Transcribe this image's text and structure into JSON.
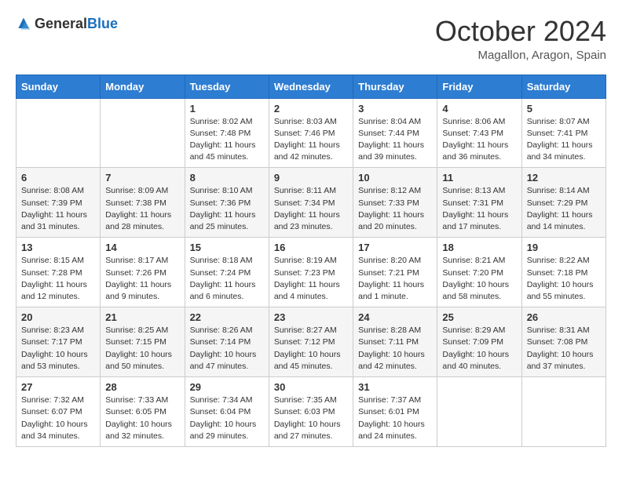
{
  "header": {
    "logo_general": "General",
    "logo_blue": "Blue",
    "month": "October 2024",
    "location": "Magallon, Aragon, Spain"
  },
  "days_of_week": [
    "Sunday",
    "Monday",
    "Tuesday",
    "Wednesday",
    "Thursday",
    "Friday",
    "Saturday"
  ],
  "weeks": [
    [
      {
        "day": "",
        "info": ""
      },
      {
        "day": "",
        "info": ""
      },
      {
        "day": "1",
        "info": "Sunrise: 8:02 AM\nSunset: 7:48 PM\nDaylight: 11 hours and 45 minutes."
      },
      {
        "day": "2",
        "info": "Sunrise: 8:03 AM\nSunset: 7:46 PM\nDaylight: 11 hours and 42 minutes."
      },
      {
        "day": "3",
        "info": "Sunrise: 8:04 AM\nSunset: 7:44 PM\nDaylight: 11 hours and 39 minutes."
      },
      {
        "day": "4",
        "info": "Sunrise: 8:06 AM\nSunset: 7:43 PM\nDaylight: 11 hours and 36 minutes."
      },
      {
        "day": "5",
        "info": "Sunrise: 8:07 AM\nSunset: 7:41 PM\nDaylight: 11 hours and 34 minutes."
      }
    ],
    [
      {
        "day": "6",
        "info": "Sunrise: 8:08 AM\nSunset: 7:39 PM\nDaylight: 11 hours and 31 minutes."
      },
      {
        "day": "7",
        "info": "Sunrise: 8:09 AM\nSunset: 7:38 PM\nDaylight: 11 hours and 28 minutes."
      },
      {
        "day": "8",
        "info": "Sunrise: 8:10 AM\nSunset: 7:36 PM\nDaylight: 11 hours and 25 minutes."
      },
      {
        "day": "9",
        "info": "Sunrise: 8:11 AM\nSunset: 7:34 PM\nDaylight: 11 hours and 23 minutes."
      },
      {
        "day": "10",
        "info": "Sunrise: 8:12 AM\nSunset: 7:33 PM\nDaylight: 11 hours and 20 minutes."
      },
      {
        "day": "11",
        "info": "Sunrise: 8:13 AM\nSunset: 7:31 PM\nDaylight: 11 hours and 17 minutes."
      },
      {
        "day": "12",
        "info": "Sunrise: 8:14 AM\nSunset: 7:29 PM\nDaylight: 11 hours and 14 minutes."
      }
    ],
    [
      {
        "day": "13",
        "info": "Sunrise: 8:15 AM\nSunset: 7:28 PM\nDaylight: 11 hours and 12 minutes."
      },
      {
        "day": "14",
        "info": "Sunrise: 8:17 AM\nSunset: 7:26 PM\nDaylight: 11 hours and 9 minutes."
      },
      {
        "day": "15",
        "info": "Sunrise: 8:18 AM\nSunset: 7:24 PM\nDaylight: 11 hours and 6 minutes."
      },
      {
        "day": "16",
        "info": "Sunrise: 8:19 AM\nSunset: 7:23 PM\nDaylight: 11 hours and 4 minutes."
      },
      {
        "day": "17",
        "info": "Sunrise: 8:20 AM\nSunset: 7:21 PM\nDaylight: 11 hours and 1 minute."
      },
      {
        "day": "18",
        "info": "Sunrise: 8:21 AM\nSunset: 7:20 PM\nDaylight: 10 hours and 58 minutes."
      },
      {
        "day": "19",
        "info": "Sunrise: 8:22 AM\nSunset: 7:18 PM\nDaylight: 10 hours and 55 minutes."
      }
    ],
    [
      {
        "day": "20",
        "info": "Sunrise: 8:23 AM\nSunset: 7:17 PM\nDaylight: 10 hours and 53 minutes."
      },
      {
        "day": "21",
        "info": "Sunrise: 8:25 AM\nSunset: 7:15 PM\nDaylight: 10 hours and 50 minutes."
      },
      {
        "day": "22",
        "info": "Sunrise: 8:26 AM\nSunset: 7:14 PM\nDaylight: 10 hours and 47 minutes."
      },
      {
        "day": "23",
        "info": "Sunrise: 8:27 AM\nSunset: 7:12 PM\nDaylight: 10 hours and 45 minutes."
      },
      {
        "day": "24",
        "info": "Sunrise: 8:28 AM\nSunset: 7:11 PM\nDaylight: 10 hours and 42 minutes."
      },
      {
        "day": "25",
        "info": "Sunrise: 8:29 AM\nSunset: 7:09 PM\nDaylight: 10 hours and 40 minutes."
      },
      {
        "day": "26",
        "info": "Sunrise: 8:31 AM\nSunset: 7:08 PM\nDaylight: 10 hours and 37 minutes."
      }
    ],
    [
      {
        "day": "27",
        "info": "Sunrise: 7:32 AM\nSunset: 6:07 PM\nDaylight: 10 hours and 34 minutes."
      },
      {
        "day": "28",
        "info": "Sunrise: 7:33 AM\nSunset: 6:05 PM\nDaylight: 10 hours and 32 minutes."
      },
      {
        "day": "29",
        "info": "Sunrise: 7:34 AM\nSunset: 6:04 PM\nDaylight: 10 hours and 29 minutes."
      },
      {
        "day": "30",
        "info": "Sunrise: 7:35 AM\nSunset: 6:03 PM\nDaylight: 10 hours and 27 minutes."
      },
      {
        "day": "31",
        "info": "Sunrise: 7:37 AM\nSunset: 6:01 PM\nDaylight: 10 hours and 24 minutes."
      },
      {
        "day": "",
        "info": ""
      },
      {
        "day": "",
        "info": ""
      }
    ]
  ]
}
